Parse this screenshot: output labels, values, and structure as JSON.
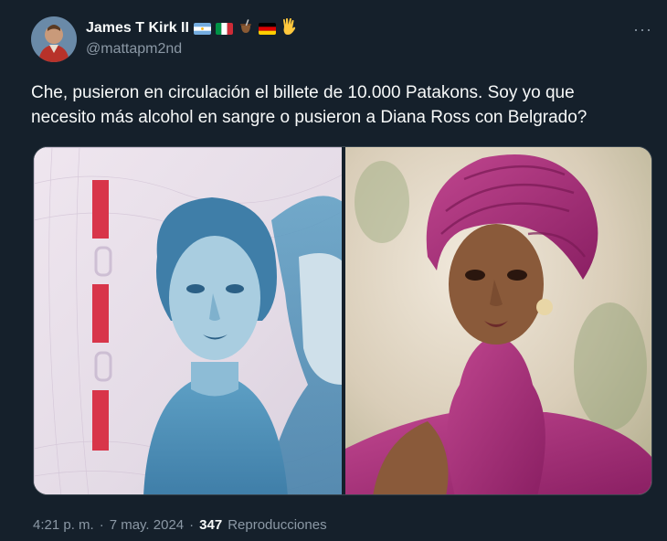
{
  "author": {
    "name": "James T Kirk II",
    "handle": "@mattapm2nd",
    "badges": [
      "flag-argentina-icon",
      "flag-italy-icon",
      "mate-icon",
      "flag-germany-icon",
      "vulcan-salute-icon"
    ]
  },
  "menu": {
    "more_label": "···"
  },
  "tweet": {
    "text": "Che, pusieron en circulación el billete de 10.000 Patakons. Soy yo que necesito más alcohol en sangre o pusieron a Diana Ross con Belgrado?"
  },
  "media": {
    "items": [
      {
        "kind": "banknote-photo"
      },
      {
        "kind": "portrait-photo"
      }
    ]
  },
  "footer": {
    "time": "4:21 p. m.",
    "separator": "·",
    "date": "7 may. 2024",
    "views_count": "347",
    "views_label": "Reproducciones"
  },
  "colors": {
    "background": "#15202b",
    "text_primary": "#f7f9f9",
    "text_secondary": "#8b98a5",
    "border": "#38444d"
  }
}
